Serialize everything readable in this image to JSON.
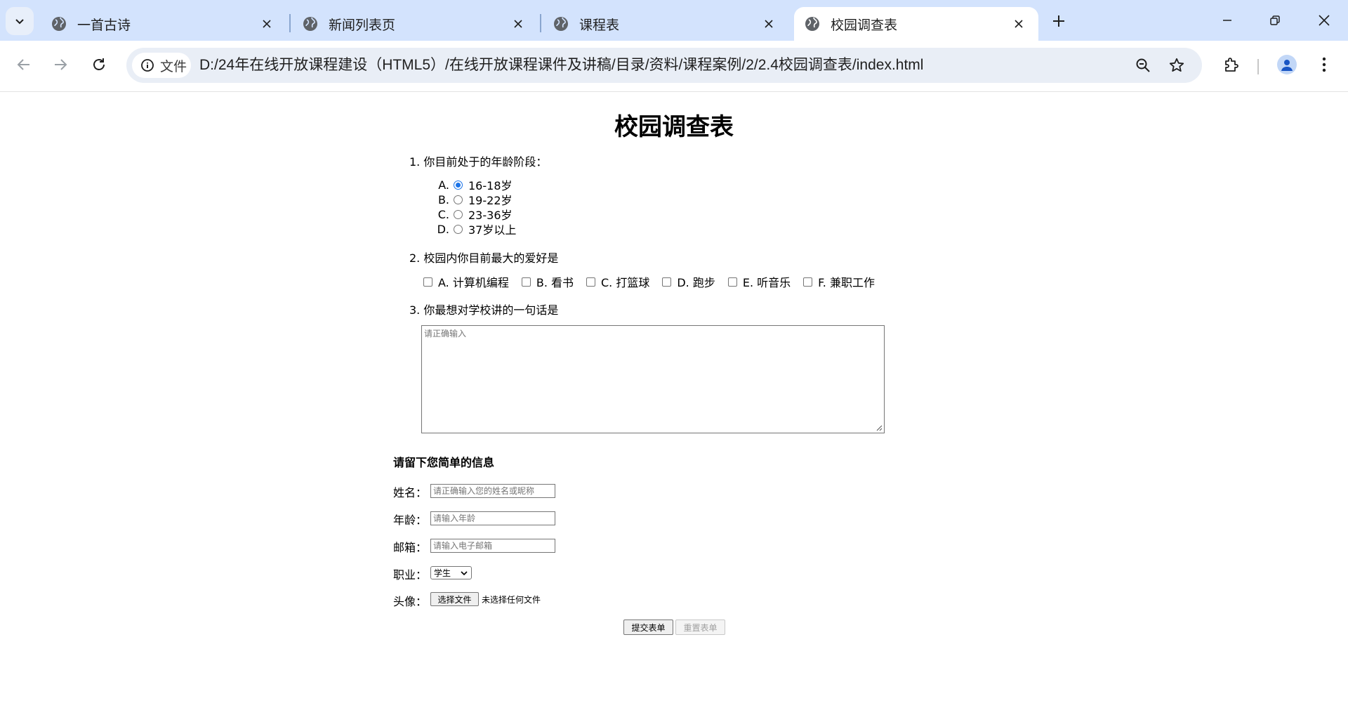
{
  "browser": {
    "tabs": [
      {
        "title": "一首古诗",
        "active": false
      },
      {
        "title": "新闻列表页",
        "active": false
      },
      {
        "title": "课程表",
        "active": false
      },
      {
        "title": "校园调查表",
        "active": true
      }
    ],
    "chip_label": "文件",
    "url": "D:/24年在线开放课程建设（HTML5）/在线开放课程课件及讲稿/目录/资料/课程案例/2/2.4校园调查表/index.html"
  },
  "page": {
    "title": "校园调查表",
    "q1": {
      "label": "1. 你目前处于的年龄阶段：",
      "options": [
        {
          "letter": "A.",
          "text": "16-18岁",
          "checked": true
        },
        {
          "letter": "B.",
          "text": "19-22岁",
          "checked": false
        },
        {
          "letter": "C.",
          "text": "23-36岁",
          "checked": false
        },
        {
          "letter": "D.",
          "text": "37岁以上",
          "checked": false
        }
      ]
    },
    "q2": {
      "label": "2. 校园内你目前最大的爱好是",
      "options": [
        "A. 计算机编程",
        "B. 看书",
        "C. 打篮球",
        "D. 跑步",
        "E. 听音乐",
        "F. 兼职工作"
      ]
    },
    "q3": {
      "label": "3. 你最想对学校讲的一句话是",
      "placeholder": "请正确输入"
    },
    "info": {
      "title": "请留下您简单的信息",
      "name_label": "姓名：",
      "name_placeholder": "请正确输入您的姓名或昵称",
      "age_label": "年龄：",
      "age_placeholder": "请输入年龄",
      "email_label": "邮箱：",
      "email_placeholder": "请输入电子邮箱",
      "job_label": "职业：",
      "job_value": "学生",
      "avatar_label": "头像：",
      "file_button": "选择文件",
      "file_status": "未选择任何文件"
    },
    "submit_label": "提交表单",
    "reset_label": "重置表单"
  }
}
